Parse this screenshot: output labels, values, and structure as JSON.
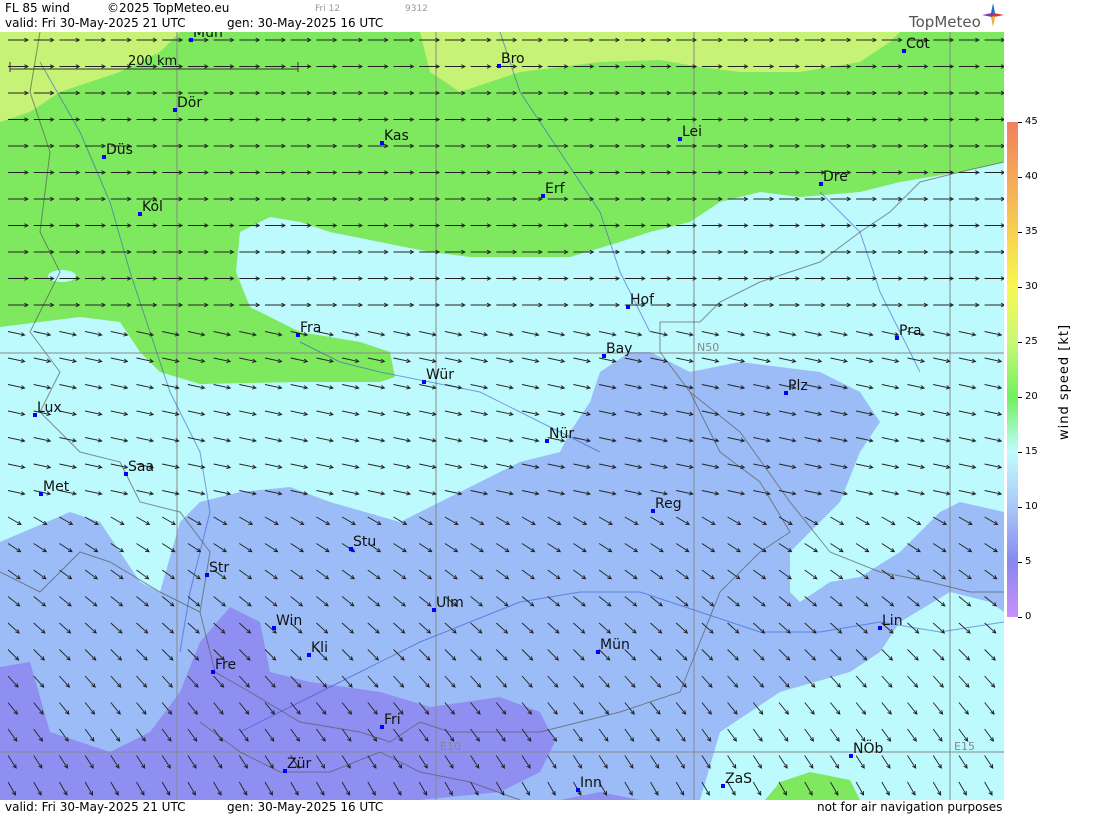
{
  "header": {
    "title": "FL 85 wind",
    "copyright": "©2025 TopMeteo.eu",
    "small_day": "Fri 12",
    "small_code": "9312",
    "valid": "valid:  Fri  30-May-2025  21 UTC",
    "generated": "gen: 30-May-2025 16 UTC",
    "brand": "TopMeteo"
  },
  "footer": {
    "valid": "valid:  Fri  30-May-2025  21 UTC",
    "generated": "gen: 30-May-2025 16 UTC",
    "disclaimer": "not for air navigation purposes"
  },
  "scale_bar": {
    "label": "200 km"
  },
  "grid_labels": {
    "lat": "N50",
    "lon1": "E10",
    "lon2": "E15"
  },
  "cities": [
    {
      "name": "Mün"
    },
    {
      "name": "Bro"
    },
    {
      "name": "Cot"
    },
    {
      "name": "Dör"
    },
    {
      "name": "Kas"
    },
    {
      "name": "Lei"
    },
    {
      "name": "Düs"
    },
    {
      "name": "Erf"
    },
    {
      "name": "Dre"
    },
    {
      "name": "Köl"
    },
    {
      "name": "Hof"
    },
    {
      "name": "Fra"
    },
    {
      "name": "Pra"
    },
    {
      "name": "Bay"
    },
    {
      "name": "Wür"
    },
    {
      "name": "Plz"
    },
    {
      "name": "Lux"
    },
    {
      "name": "Nür"
    },
    {
      "name": "Saa"
    },
    {
      "name": "Met"
    },
    {
      "name": "Reg"
    },
    {
      "name": "Stu"
    },
    {
      "name": "Str"
    },
    {
      "name": "Ulm"
    },
    {
      "name": "Win"
    },
    {
      "name": "Lin"
    },
    {
      "name": "Kli"
    },
    {
      "name": "Mün"
    },
    {
      "name": "Fre"
    },
    {
      "name": "Fri"
    },
    {
      "name": "NÖb"
    },
    {
      "name": "Zür"
    },
    {
      "name": "ZaS"
    },
    {
      "name": "Inn"
    }
  ],
  "legend": {
    "title": "wind speed [kt]",
    "ticks": [
      "45",
      "40",
      "35",
      "30",
      "25",
      "20",
      "15",
      "10",
      "5",
      "0"
    ],
    "colors": [
      "#f08060",
      "#f4a85a",
      "#f8d050",
      "#f8f850",
      "#c8f878",
      "#70f060",
      "#c0fcfc",
      "#a8c8f8",
      "#8888f0",
      "#c890f8"
    ]
  },
  "colors": {
    "wind_lt10": "#8f8ff2",
    "wind_10_15": "#9bbcf6",
    "wind_15_20": "#bdfafd",
    "wind_20_25": "#7ee85e",
    "wind_25_30": "#c6f276"
  }
}
